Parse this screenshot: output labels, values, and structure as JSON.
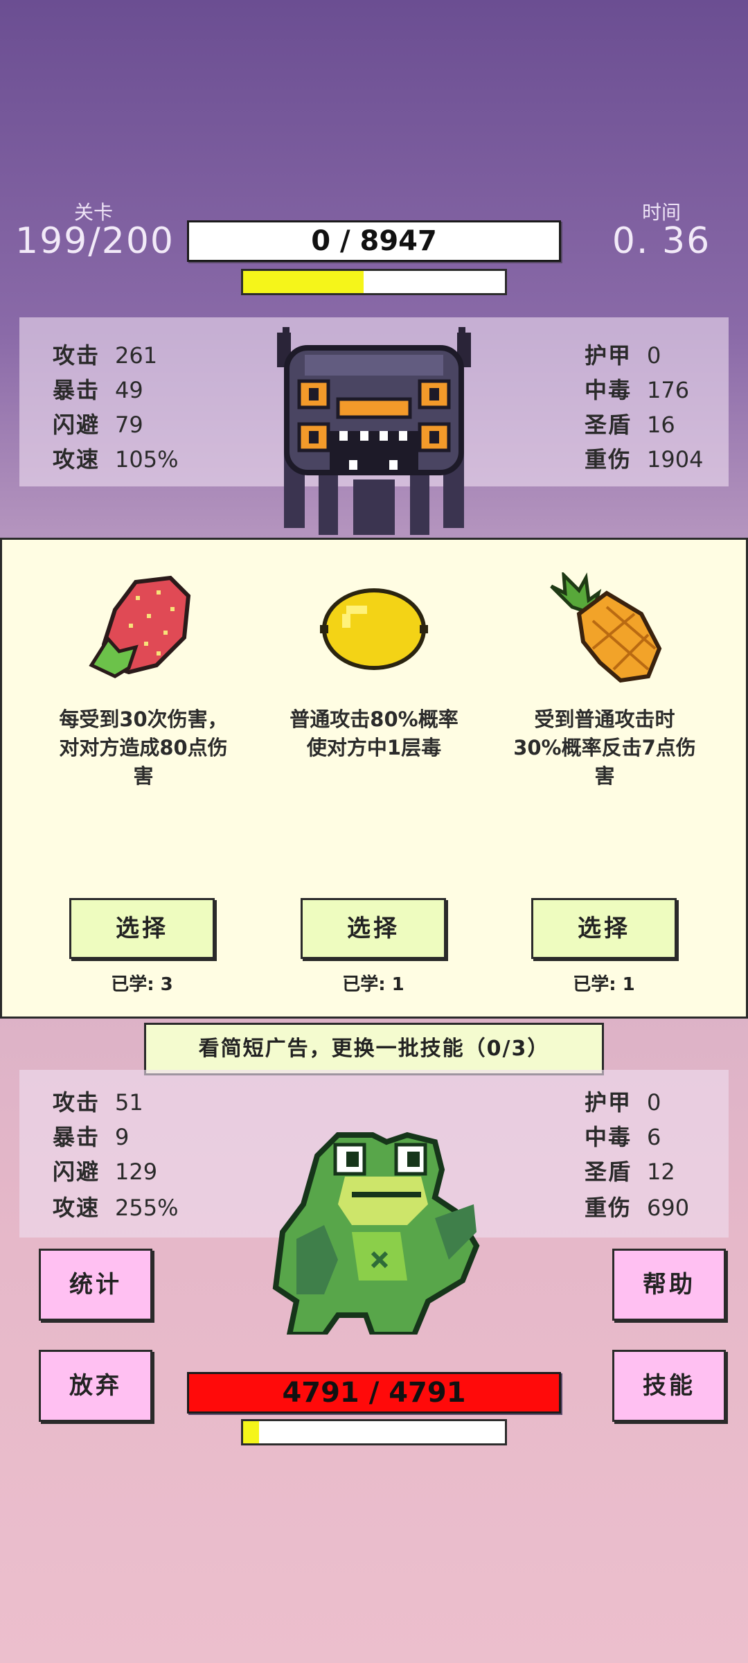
{
  "hud": {
    "level_label": "关卡",
    "level_value": "199/200",
    "time_label": "时间",
    "time_value": "0. 36",
    "enemy_hp_text": "0  /  8947",
    "enemy_xp_fraction": 0.46
  },
  "enemy_stats": {
    "left": [
      {
        "k": "攻击",
        "v": "261"
      },
      {
        "k": "暴击",
        "v": "49"
      },
      {
        "k": "闪避",
        "v": "79"
      },
      {
        "k": "攻速",
        "v": "105%"
      }
    ],
    "right": [
      {
        "k": "护甲",
        "v": "0"
      },
      {
        "k": "中毒",
        "v": "176"
      },
      {
        "k": "圣盾",
        "v": "16"
      },
      {
        "k": "重伤",
        "v": "1904"
      }
    ]
  },
  "choices": [
    {
      "icon": "strawberry-icon",
      "desc": "每受到30次伤害，对对方造成80点伤害",
      "select": "选择",
      "learned": "已学: 3"
    },
    {
      "icon": "lemon-icon",
      "desc": "普通攻击80%概率使对方中1层毒",
      "select": "选择",
      "learned": "已学: 1"
    },
    {
      "icon": "pineapple-icon",
      "desc": "受到普通攻击时30%概率反击7点伤害",
      "select": "选择",
      "learned": "已学: 1"
    }
  ],
  "ad_refresh_label": "看简短广告，更换一批技能（0/3）",
  "player_stats": {
    "left": [
      {
        "k": "攻击",
        "v": "51"
      },
      {
        "k": "暴击",
        "v": "9"
      },
      {
        "k": "闪避",
        "v": "129"
      },
      {
        "k": "攻速",
        "v": "255%"
      }
    ],
    "right": [
      {
        "k": "护甲",
        "v": "0"
      },
      {
        "k": "中毒",
        "v": "6"
      },
      {
        "k": "圣盾",
        "v": "12"
      },
      {
        "k": "重伤",
        "v": "690"
      }
    ]
  },
  "buttons": {
    "stats": "统计",
    "help": "帮助",
    "give_up": "放弃",
    "skills": "技能"
  },
  "player": {
    "hp_text": "4791  /  4791",
    "xp_fraction": 0.06
  },
  "colors": {
    "enemy_hp_bg": "#ffffff",
    "player_hp_bg": "#ff0a0a",
    "xp_fill": "#f5f51a",
    "panel_bg": "#fffde3",
    "select_bg": "#eefcbf",
    "pink_button": "#ffc0f2"
  }
}
